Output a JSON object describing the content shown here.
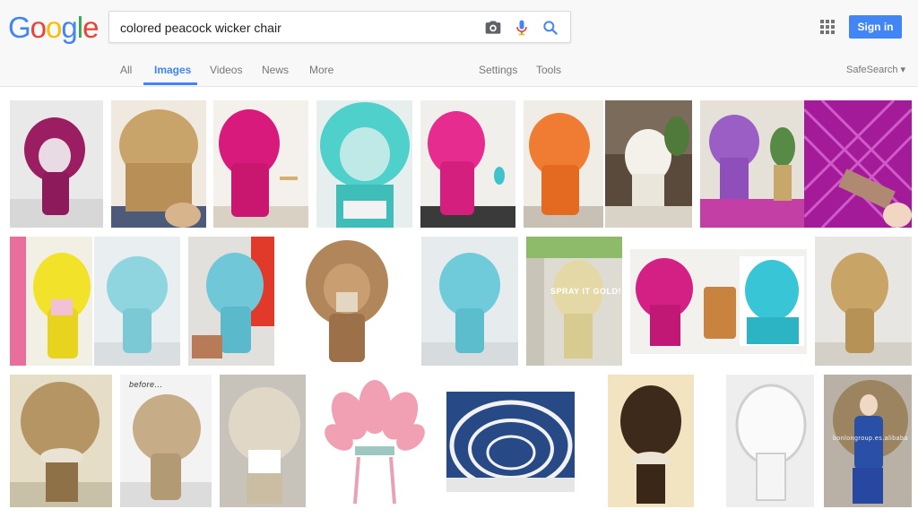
{
  "logo": [
    "G",
    "o",
    "o",
    "g",
    "l",
    "e"
  ],
  "logo_colors": [
    "#4285f4",
    "#ea4335",
    "#fbbc05",
    "#4285f4",
    "#34a853",
    "#ea4335"
  ],
  "search": {
    "value": "colored peacock wicker chair"
  },
  "icons": {
    "camera": "camera-icon",
    "mic": "microphone-icon",
    "search": "search-icon",
    "apps": "apps-grid-icon"
  },
  "header": {
    "signin_label": "Sign in"
  },
  "nav": {
    "tabs": [
      {
        "label": "All"
      },
      {
        "label": "Images"
      },
      {
        "label": "Videos"
      },
      {
        "label": "News"
      },
      {
        "label": "More"
      }
    ],
    "settings": "Settings",
    "tools": "Tools",
    "safesearch": "SafeSearch ▾"
  },
  "image_overlays": {
    "spray": "SPRAY IT GOLD!",
    "before": "before...",
    "watermark": "bonlongroup.es.alibaba"
  },
  "colors": {
    "accent": "#4285f4"
  }
}
